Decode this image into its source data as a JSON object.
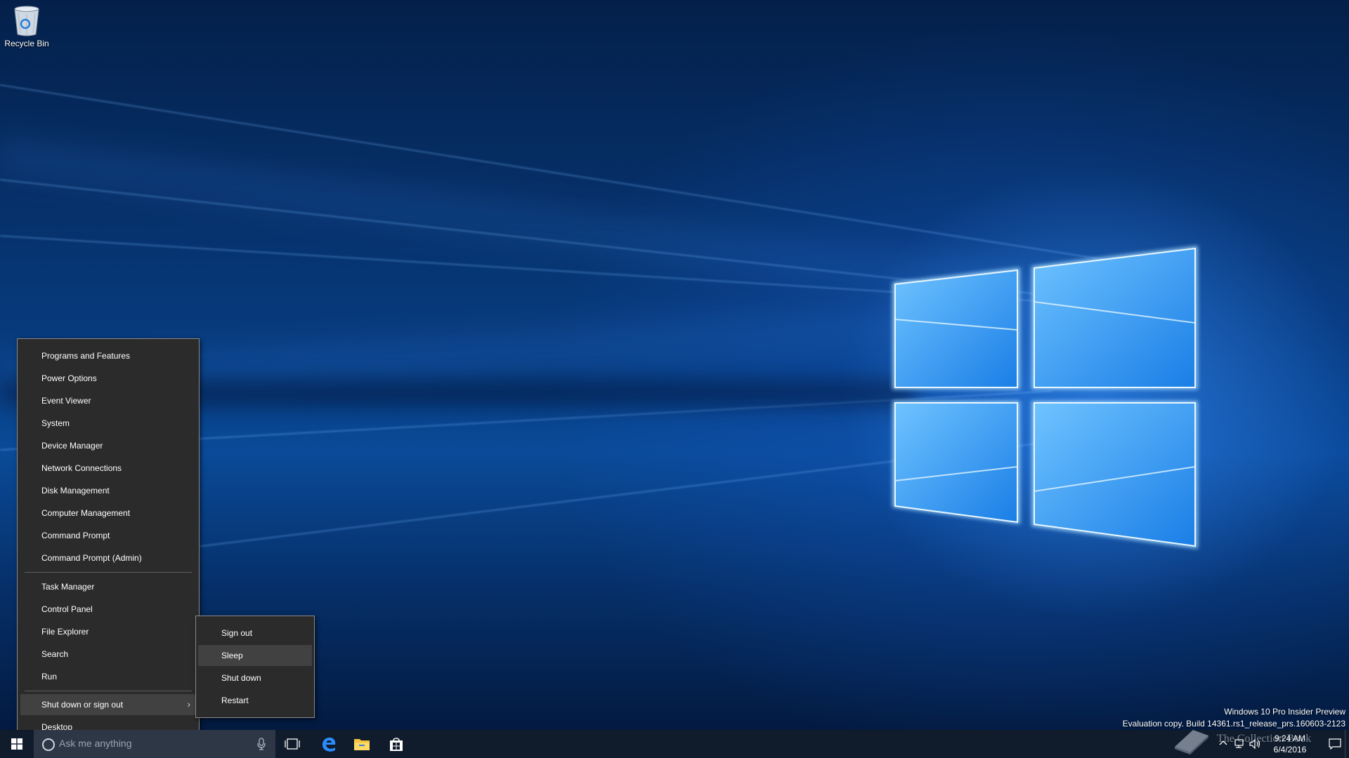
{
  "desktop": {
    "icons": [
      {
        "label": "Recycle Bin",
        "icon": "recycle-bin-icon"
      }
    ]
  },
  "winx_menu": {
    "group1": [
      "Programs and Features",
      "Power Options",
      "Event Viewer",
      "System",
      "Device Manager",
      "Network Connections",
      "Disk Management",
      "Computer Management",
      "Command Prompt",
      "Command Prompt (Admin)"
    ],
    "group2": [
      "Task Manager",
      "Control Panel",
      "File Explorer",
      "Search",
      "Run"
    ],
    "shutdown": "Shut down or sign out",
    "desktop": "Desktop"
  },
  "power_menu": {
    "items": [
      "Sign out",
      "Sleep",
      "Shut down",
      "Restart"
    ],
    "highlighted": "Sleep"
  },
  "taskbar": {
    "search_placeholder": "Ask me anything",
    "pinned": [
      {
        "name": "Task View",
        "icon": "task-view-icon"
      },
      {
        "name": "Microsoft Edge",
        "icon": "edge-icon"
      },
      {
        "name": "File Explorer",
        "icon": "folder-icon"
      },
      {
        "name": "Store",
        "icon": "store-icon"
      }
    ]
  },
  "tray": {
    "time": "9:24 AM",
    "date": "6/4/2016"
  },
  "watermark": {
    "line1": "Windows 10 Pro Insider Preview",
    "line2": "Evaluation copy. Build 14361.rs1_release_prs.160603-2123"
  },
  "brand": {
    "text": "The Collection Book"
  },
  "colors": {
    "menu_bg": "#2b2b2b",
    "menu_hover": "#414141",
    "taskbar_bg": "#101b2b",
    "search_bg": "#2d3746"
  }
}
